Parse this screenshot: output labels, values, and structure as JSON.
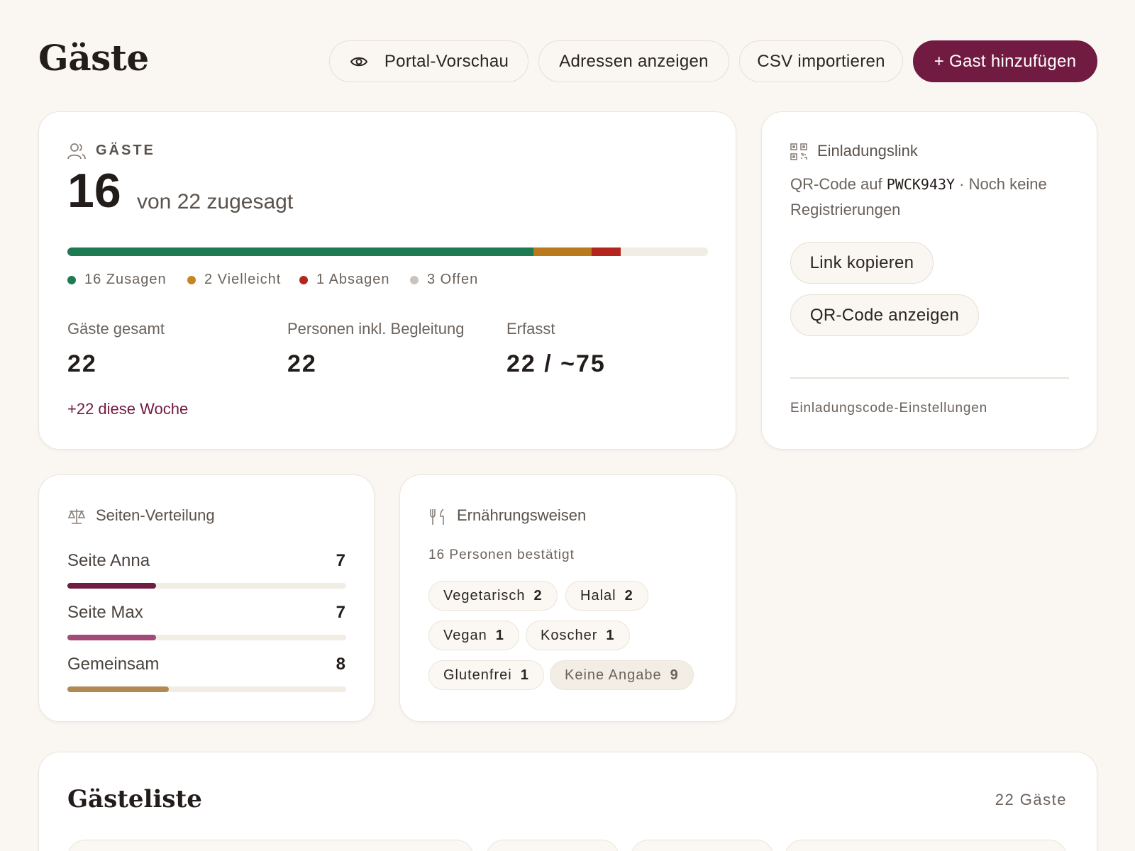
{
  "header": {
    "title": "Gäste",
    "buttons": {
      "portal_preview": "Portal-Vorschau",
      "show_addresses": "Adressen anzeigen",
      "import_csv": "CSV importieren",
      "add_guest": "+ Gast hinzufügen"
    }
  },
  "guests_card": {
    "section_label": "GÄSTE",
    "confirmed_count": "16",
    "confirmed_suffix": "von 22 zugesagt",
    "rsvp_bar": {
      "total": 22,
      "segments": [
        {
          "name": "Zusagen",
          "count": 16,
          "color": "#1e7a52"
        },
        {
          "name": "Vielleicht",
          "count": 2,
          "color": "#b97a1e"
        },
        {
          "name": "Absagen",
          "count": 1,
          "color": "#b3261e"
        },
        {
          "name": "Offen",
          "count": 3,
          "color": "#f1ece4"
        }
      ]
    },
    "legend": [
      {
        "label": "16 Zusagen",
        "color": "#1e7a52"
      },
      {
        "label": "2 Vielleicht",
        "color": "#c48524"
      },
      {
        "label": "1 Absagen",
        "color": "#b3261e"
      },
      {
        "label": "3 Offen",
        "color": "#c9c4bd"
      }
    ],
    "stats": [
      {
        "label": "Gäste gesamt",
        "value": "22"
      },
      {
        "label": "Personen inkl. Begleitung",
        "value": "22"
      },
      {
        "label": "Erfasst",
        "value": "22 / ~75"
      }
    ],
    "weekly_change": "+22 diese Woche"
  },
  "invite_card": {
    "title": "Einladungslink",
    "desc_prefix": "QR-Code auf ",
    "code": "PWCK943Y",
    "desc_suffix": " · Noch keine Registrierungen",
    "copy_link": "Link kopieren",
    "show_qr": "QR-Code anzeigen",
    "settings_link": "Einladungscode-Einstellungen"
  },
  "sides_card": {
    "title": "Seiten-Verteilung",
    "max": 22,
    "items": [
      {
        "label": "Seite Anna",
        "value": 7,
        "color": "#711a42"
      },
      {
        "label": "Seite Max",
        "value": 7,
        "color": "#a24a78"
      },
      {
        "label": "Gemeinsam",
        "value": 8,
        "color": "#b08a52"
      }
    ]
  },
  "diet_card": {
    "title": "Ernährungsweisen",
    "subtitle": "16 Personen bestätigt",
    "chips": [
      {
        "label": "Vegetarisch",
        "count": "2"
      },
      {
        "label": "Halal",
        "count": "2"
      },
      {
        "label": "Vegan",
        "count": "1"
      },
      {
        "label": "Koscher",
        "count": "1"
      },
      {
        "label": "Glutenfrei",
        "count": "1"
      },
      {
        "label": "Keine Angabe",
        "count": "9"
      }
    ]
  },
  "guest_list": {
    "title": "Gästeliste",
    "count": "22 Gäste"
  }
}
